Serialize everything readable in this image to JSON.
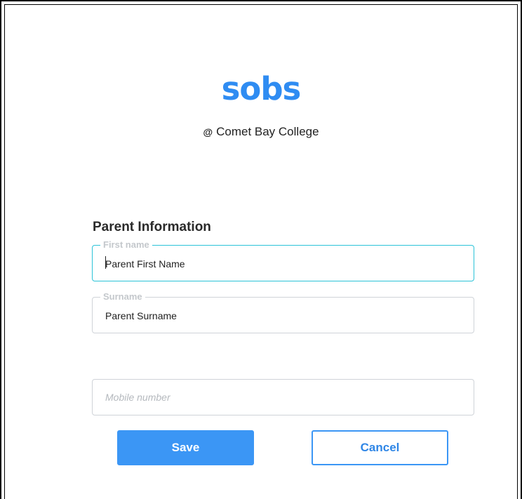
{
  "brand": {
    "logo_text": "sobs",
    "logo_color": "#2f8cf2",
    "at_symbol": "@",
    "school": "Comet Bay College"
  },
  "form": {
    "section_title": "Parent Information",
    "first_name": {
      "label": "First name",
      "value": "Parent First Name"
    },
    "surname": {
      "label": "Surname",
      "value": "Parent Surname"
    },
    "mobile": {
      "placeholder": "Mobile number"
    }
  },
  "actions": {
    "save_label": "Save",
    "cancel_label": "Cancel",
    "accent_color": "#3b96f5",
    "focus_color": "#2bc3d8"
  }
}
